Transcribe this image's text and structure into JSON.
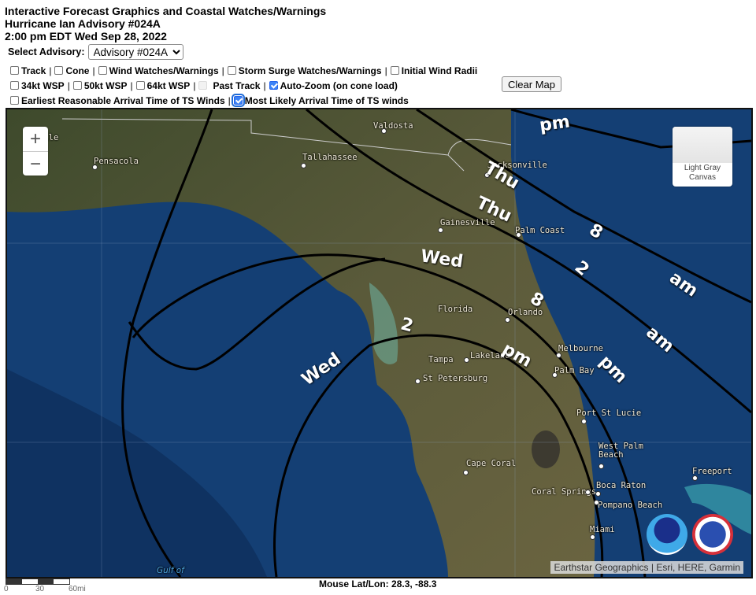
{
  "header": {
    "line1": "Interactive Forecast Graphics and Coastal Watches/Warnings",
    "line2": "Hurricane Ian Advisory #024A",
    "line3": "2:00 pm EDT Wed Sep 28, 2022"
  },
  "advisory_select": {
    "label": "Select Advisory:",
    "value": "Advisory #024A"
  },
  "options": {
    "row1": [
      {
        "label": "Track",
        "checked": false
      },
      {
        "label": "Cone",
        "checked": false
      },
      {
        "label": "Wind Watches/Warnings",
        "checked": false
      },
      {
        "label": "Storm Surge Watches/Warnings",
        "checked": false
      },
      {
        "label": "Initial Wind Radii",
        "checked": false
      }
    ],
    "row2": [
      {
        "label": "34kt WSP",
        "checked": false
      },
      {
        "label": "50kt WSP",
        "checked": false
      },
      {
        "label": "64kt WSP",
        "checked": false
      },
      {
        "label": "Past Track",
        "checked": false,
        "disabled": true
      },
      {
        "label": "Auto-Zoom (on cone load)",
        "checked": true
      }
    ],
    "row3": [
      {
        "label": "Earliest Reasonable Arrival Time of TS Winds",
        "checked": false
      },
      {
        "label": "Most Likely Arrival Time of TS winds",
        "checked": true
      }
    ],
    "separator": "|"
  },
  "clear_map_label": "Clear Map",
  "map": {
    "zoom_in": "+",
    "zoom_out": "−",
    "basemap_label": "Light Gray Canvas",
    "attribution": "Earthstar Geographics | Esri, HERE, Garmin",
    "water_label": "Gulf of",
    "cities": [
      {
        "name": "Mobile",
        "display": "bile"
      },
      {
        "name": "Pensacola"
      },
      {
        "name": "Valdosta"
      },
      {
        "name": "Tallahassee"
      },
      {
        "name": "Jacksonville"
      },
      {
        "name": "Gainesville"
      },
      {
        "name": "Palm Coast"
      },
      {
        "name": "Florida"
      },
      {
        "name": "Orlando"
      },
      {
        "name": "Tampa"
      },
      {
        "name": "Lakeland"
      },
      {
        "name": "St Petersburg"
      },
      {
        "name": "Melbourne"
      },
      {
        "name": "Palm Bay"
      },
      {
        "name": "Port St Lucie"
      },
      {
        "name": "West Palm Beach"
      },
      {
        "name": "Cape Coral"
      },
      {
        "name": "Freeport"
      },
      {
        "name": "Coral Springs"
      },
      {
        "name": "Boca Raton"
      },
      {
        "name": "Pompano Beach"
      },
      {
        "name": "Miami"
      }
    ],
    "arrival_contour_labels": [
      "pm",
      "Thu",
      "Thu",
      "8",
      "Wed",
      "2",
      "am",
      "8",
      "am",
      "2",
      "Wed",
      "pm",
      "pm"
    ],
    "logos": [
      "NOAA",
      "National Weather Service"
    ]
  },
  "scale": {
    "labels": [
      "0",
      "30",
      "60mi"
    ]
  },
  "mouse_readout": {
    "label": "Mouse Lat/Lon:",
    "value": "28.3, -88.3"
  }
}
